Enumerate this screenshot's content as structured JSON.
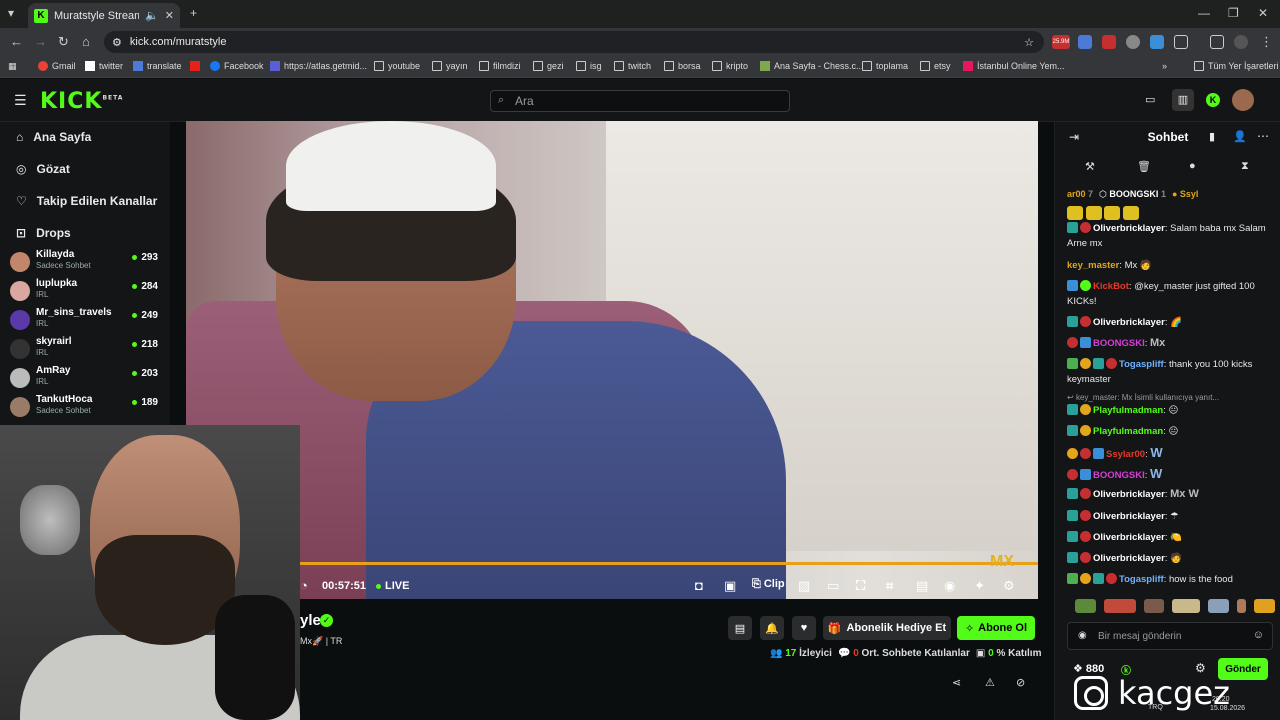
{
  "browser": {
    "tab_title": "Muratstyle Stream - Watch",
    "url": "kick.com/muratstyle",
    "extension_badge": "25.9M",
    "bookmarks": [
      "Gmail",
      "twitter",
      "translate",
      "",
      "Facebook",
      "https://atlas.getmid...",
      "youtube",
      "yayın",
      "filmdizi",
      "gezi",
      "isg",
      "twitch",
      "borsa",
      "kripto",
      "Ana Sayfa - Chess.c...",
      "toplama",
      "etsy",
      "İstanbul Online Yem..."
    ],
    "bookmarks_all": "Tüm Yer İşaretleri"
  },
  "header": {
    "logo": "KICK",
    "logo_beta": "BETA",
    "search_placeholder": "Ara"
  },
  "sidebar": {
    "nav": [
      "Ana Sayfa",
      "Gözat",
      "Takip Edilen Kanallar",
      "Drops"
    ],
    "channels": [
      {
        "name": "Killayda",
        "category": "Sadece Sohbet",
        "viewers": "293"
      },
      {
        "name": "luplupka",
        "category": "IRL",
        "viewers": "284"
      },
      {
        "name": "Mr_sins_travels",
        "category": "IRL",
        "viewers": "249"
      },
      {
        "name": "skyrairl",
        "category": "IRL",
        "viewers": "218"
      },
      {
        "name": "AmRay",
        "category": "IRL",
        "viewers": "203"
      },
      {
        "name": "TankutHoca",
        "category": "Sadece Sohbet",
        "viewers": "189"
      }
    ]
  },
  "player": {
    "time": "00:57:51",
    "live": "LIVE",
    "clip": "Clip",
    "watermark": "MX"
  },
  "stream_info": {
    "name_fragment": "yle",
    "sub_fragment": "Mx🚀 | TR",
    "gift_sub": "Abonelik Hediye Et",
    "subscribe": "Abone Ol",
    "viewers_count": "17",
    "viewers_label": "İzleyici",
    "chatters_count": "0",
    "chatters_label": "Ort. Sohbete Katılanlar",
    "participation_count": "0",
    "participation_label": "% Katılım"
  },
  "chat": {
    "title": "Sohbet",
    "pinned": [
      {
        "name": "ar00",
        "count": "7"
      },
      {
        "name": "BOONGSKI",
        "count": "1"
      },
      {
        "name": "Ssyl",
        "count": ""
      }
    ],
    "messages": [
      {
        "user": "Oliverbricklayer",
        "color": "#ffffff",
        "text": "Salam baba mx Salam Arne mx"
      },
      {
        "user": "key_master",
        "color": "#e2a51b",
        "text": "Mx 🧑"
      },
      {
        "user": "KickBot",
        "color": "#e5382c",
        "text": "@key_master just gifted 100 KICKs!"
      },
      {
        "user": "Oliverbricklayer",
        "color": "#ffffff",
        "text": "🌈"
      },
      {
        "user": "BOONGSKI",
        "color": "#d53fd8",
        "text": "Mx"
      },
      {
        "user": "Togaspliff",
        "color": "#6fb3ff",
        "text": "thank you 100 kicks keymaster"
      },
      {
        "user": "key_master",
        "color": "#9a9a9a",
        "text": "Mx  İsimli kullanıcıya yanıt..."
      },
      {
        "user": "Playfulmadman",
        "color": "#53fc18",
        "text": "😐"
      },
      {
        "user": "Playfulmadman",
        "color": "#53fc18",
        "text": "😐"
      },
      {
        "user": "Ssylar00",
        "color": "#e5382c",
        "text": "W"
      },
      {
        "user": "BOONGSKI",
        "color": "#d53fd8",
        "text": "W"
      },
      {
        "user": "Oliverbricklayer",
        "color": "#ffffff",
        "text": "Mx W"
      },
      {
        "user": "Oliverbricklayer",
        "color": "#ffffff",
        "text": "☂"
      },
      {
        "user": "Oliverbricklayer",
        "color": "#ffffff",
        "text": "🍋"
      },
      {
        "user": "Oliverbricklayer",
        "color": "#ffffff",
        "text": "🧑"
      },
      {
        "user": "Togaspliff",
        "color": "#6fb3ff",
        "text": "how is the food"
      }
    ],
    "input_placeholder": "Bir mesaj gönderin",
    "kicks_count": "880",
    "send": "Gönder"
  },
  "overlay": {
    "instagram_handle": "kacgez"
  },
  "taskbar": {
    "lang": "TRQ",
    "time": "20:20",
    "date": "15.08.2026"
  },
  "colors": {
    "accent": "#53fc18",
    "seek": "#e8a019"
  }
}
